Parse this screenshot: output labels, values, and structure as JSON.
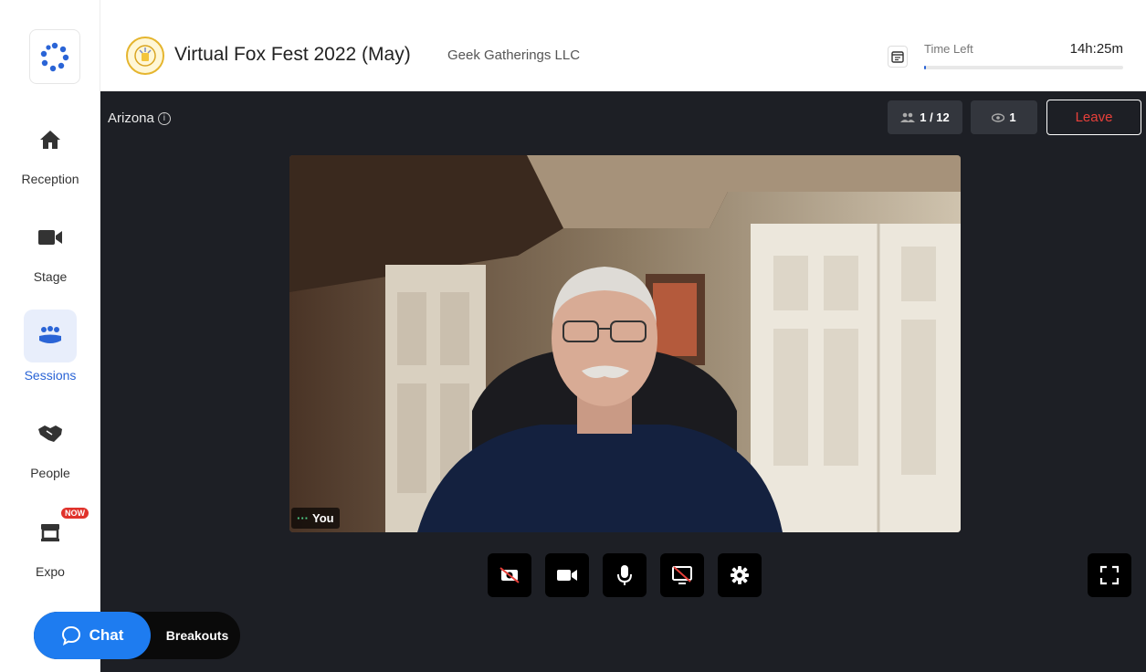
{
  "event": {
    "title": "Virtual Fox Fest 2022 (May)",
    "organizer": "Geek Gatherings LLC",
    "time_left_label": "Time Left",
    "time_left_value": "14h:25m",
    "time_left_progress": 0.01
  },
  "sidebar": {
    "items": [
      {
        "label": "Reception",
        "icon": "home-icon"
      },
      {
        "label": "Stage",
        "icon": "video-camera-icon"
      },
      {
        "label": "Sessions",
        "icon": "group-icon",
        "active": true
      },
      {
        "label": "People",
        "icon": "handshake-icon"
      },
      {
        "label": "Expo",
        "icon": "booth-icon",
        "badge": "NOW"
      }
    ]
  },
  "room": {
    "name": "Arizona",
    "participants": "1 / 12",
    "viewers": "1",
    "leave_label": "Leave"
  },
  "video": {
    "tile_label": "You"
  },
  "controls": [
    "camera-off-icon",
    "video-camera-icon",
    "microphone-icon",
    "screen-share-off-icon",
    "settings-icon",
    "fullscreen-icon"
  ],
  "chat": {
    "chat_label": "Chat",
    "breakouts_label": "Breakouts"
  },
  "colors": {
    "accent": "#2a64d6",
    "chat_blue": "#1e7cf0",
    "leave_red": "#e8403a",
    "stage_bg": "#1d1f25"
  }
}
